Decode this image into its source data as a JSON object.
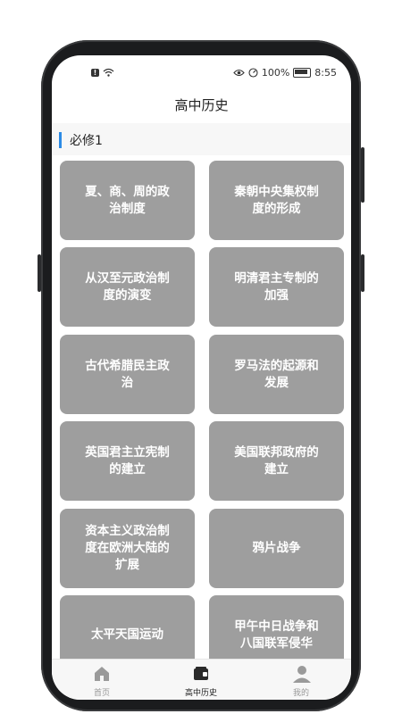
{
  "status_bar": {
    "battery_percent": "100%",
    "time": "8:55"
  },
  "header": {
    "title": "高中历史"
  },
  "section": {
    "title": "必修1"
  },
  "lessons": [
    "夏、商、周的政治制度",
    "秦朝中央集权制度的形成",
    "从汉至元政治制度的演变",
    "明清君主专制的加强",
    "古代希腊民主政治",
    "罗马法的起源和发展",
    "英国君主立宪制的建立",
    "美国联邦政府的建立",
    "资本主义政治制度在欧洲大陆的扩展",
    "鸦片战争",
    "太平天国运动",
    "甲午中日战争和八国联军侵华"
  ],
  "tabs": [
    {
      "label": "首页",
      "icon": "home-icon"
    },
    {
      "label": "高中历史",
      "icon": "book-icon"
    },
    {
      "label": "我的",
      "icon": "person-icon"
    }
  ],
  "colors": {
    "card": "#9e9e9e",
    "accent": "#2b8be6"
  }
}
